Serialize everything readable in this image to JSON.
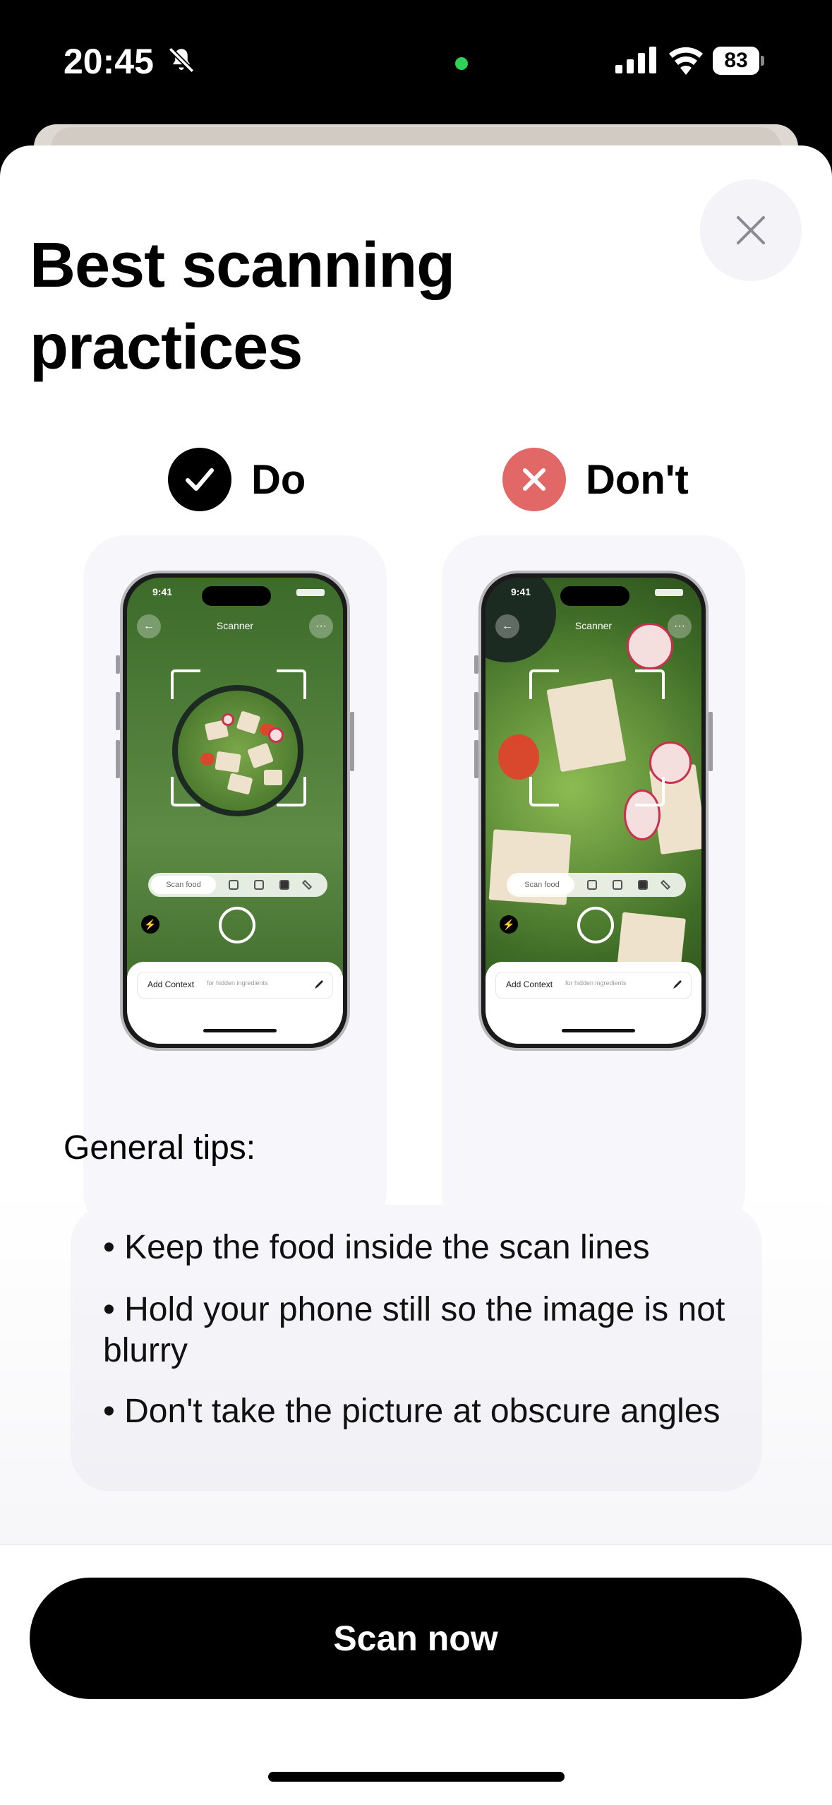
{
  "status_bar": {
    "time": "20:45",
    "battery": "83"
  },
  "header": {
    "title": "Best scanning practices",
    "close_icon": "close-icon"
  },
  "comparison": {
    "do": {
      "label": "Do",
      "badge_color": "#000000"
    },
    "dont": {
      "label": "Don't",
      "badge_color": "#e26767"
    },
    "mock_phone": {
      "time": "9:41",
      "title": "Scanner",
      "mode_label": "Scan food",
      "context_label": "Add Context",
      "context_hint": "for hidden ingredients"
    }
  },
  "tips": {
    "title": "General tips:",
    "items": [
      "• Keep the food inside the scan lines",
      "• Hold your phone still so the image is not blurry",
      "• Don't take the picture at obscure angles"
    ]
  },
  "actions": {
    "scan_label": "Scan now"
  }
}
